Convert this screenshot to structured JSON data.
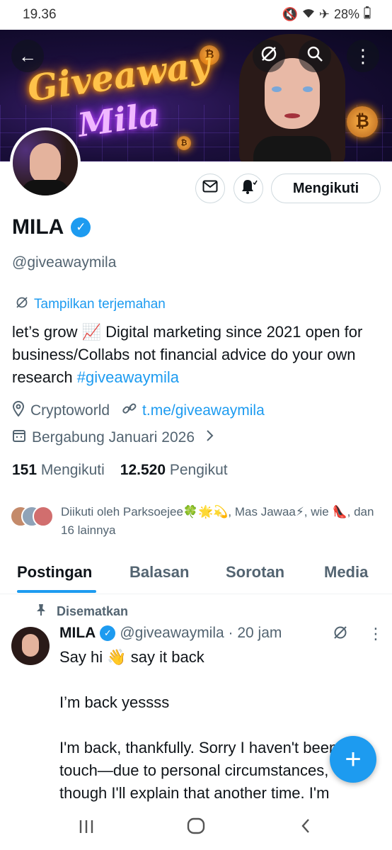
{
  "status_bar": {
    "time": "19.36",
    "icons": [
      "mute-icon",
      "wifi-icon",
      "airplane-icon"
    ],
    "battery": "28%"
  },
  "banner": {
    "title_line1": "Giveaway",
    "title_line2": "Mila",
    "coin_symbol": "₿",
    "buttons": [
      "back-arrow-icon",
      "translate-icon",
      "search-icon",
      "more-vertical-icon"
    ]
  },
  "profile": {
    "name": "MILA",
    "handle": "@giveawaymila",
    "translate_label": "Tampilkan terjemahan",
    "bio_text": "let’s grow 📈 Digital marketing since 2021 open for business/Collabs not financial advice do your own research ",
    "bio_hashtag": "#giveawaymila",
    "location": "Cryptoworld",
    "link": "t.me/giveawaymila",
    "joined": "Bergabung Januari 2026",
    "following_count": "151",
    "following_label": "Mengikuti",
    "followers_count": "12.520",
    "followers_label": "Pengikut",
    "followed_by": "Diikuti oleh Parksoejee🍀🌟💫, Mas Jawaa⚡, wie 👠, dan 16 lainnya"
  },
  "actions": {
    "message_icon": "envelope-icon",
    "notify_icon": "bell-icon",
    "follow_label": "Mengikuti"
  },
  "tabs": [
    {
      "label": "Postingan",
      "active": true
    },
    {
      "label": "Balasan",
      "active": false
    },
    {
      "label": "Sorotan",
      "active": false
    },
    {
      "label": "Media",
      "active": false
    }
  ],
  "post": {
    "pinned_label": "Disematkan",
    "author": "MILA",
    "handle_time": "@giveawaymila · 20 jam",
    "line1": "Say hi 👋 say it back",
    "line2": "I’m back yessss",
    "line3": "I'm back, thankfully. Sorry I haven't been in touch—due to personal circumstances, though I'll explain that another time. I'm"
  },
  "fab": {
    "icon": "plus-icon"
  },
  "colors": {
    "accent": "#1d9bf0",
    "text_primary": "#0f1419",
    "text_secondary": "#536471"
  }
}
